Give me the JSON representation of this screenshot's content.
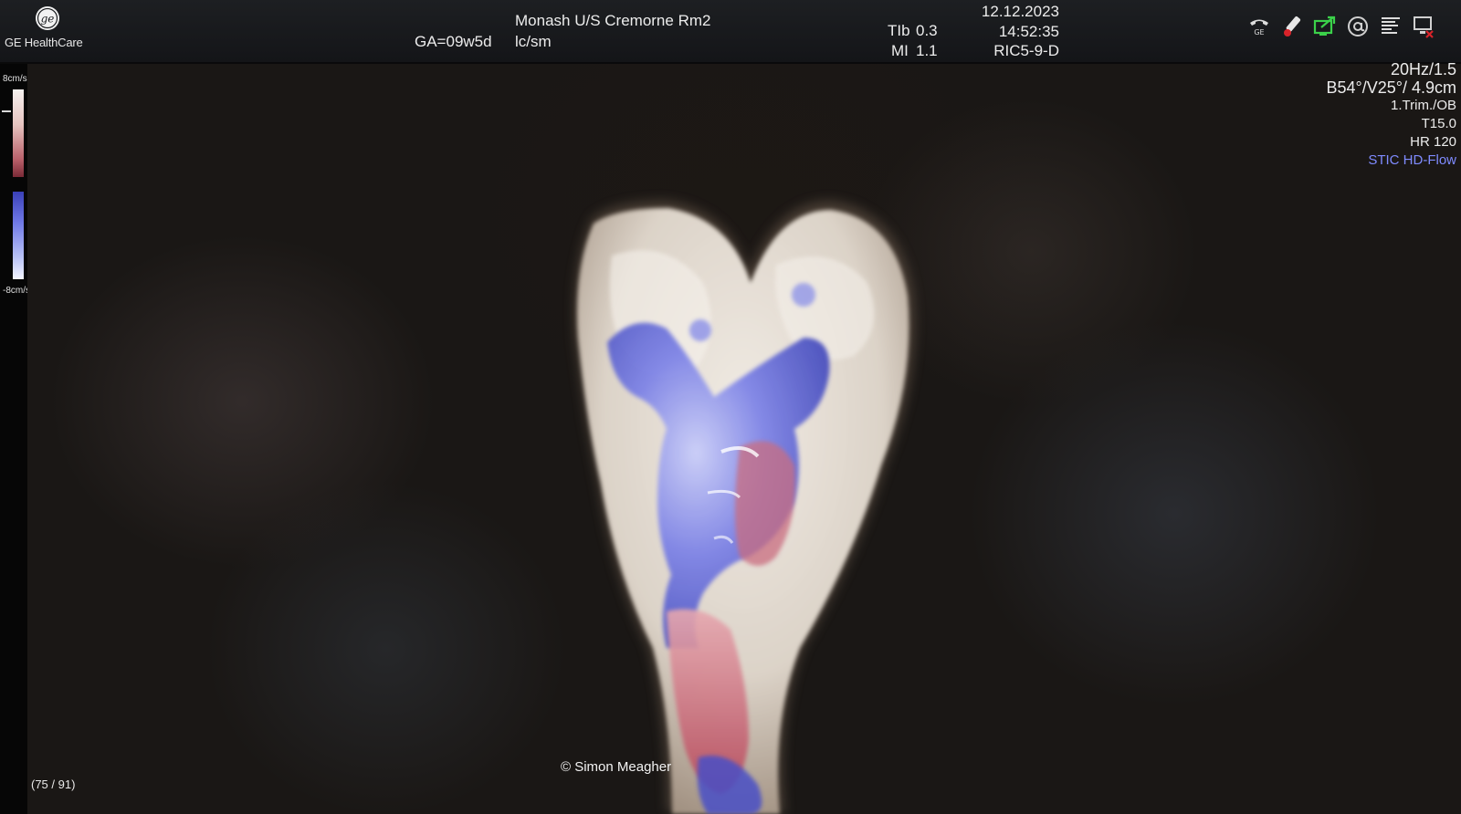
{
  "header": {
    "brand": "GE HealthCare",
    "gestational_age": "GA=09w5d",
    "institution": "Monash U/S Cremorne Rm2",
    "operator": "lc/sm",
    "tib_label": "TIb",
    "tib_value": "0.3",
    "mi_label": "MI",
    "mi_value": "1.1",
    "date": "12.12.2023",
    "time": "14:52:35",
    "probe": "RIC5-9-D",
    "status_icons": [
      "ge-phone-icon",
      "probe-icon",
      "network-screen-icon",
      "at-icon",
      "report-icon",
      "monitor-error-icon"
    ]
  },
  "scale": {
    "top_label": "8cm/s",
    "bottom_label": "-8cm/s"
  },
  "params": {
    "frame_rate": "20Hz/1.5",
    "geometry": "B54°/V25°/ 4.9cm",
    "preset": "1.Trim./OB",
    "thermal": "T15.0",
    "heart_rate": "HR 120",
    "mode": "STIC HD-Flow"
  },
  "footer": {
    "frame_counter": "(75 / 91)",
    "copyright": "© Simon Meagher"
  },
  "colors": {
    "mode_accent": "#7f8bff",
    "flow_blue": "#5a60d8",
    "flow_red": "#c05a6a",
    "tissue": "#e2dbd2"
  }
}
